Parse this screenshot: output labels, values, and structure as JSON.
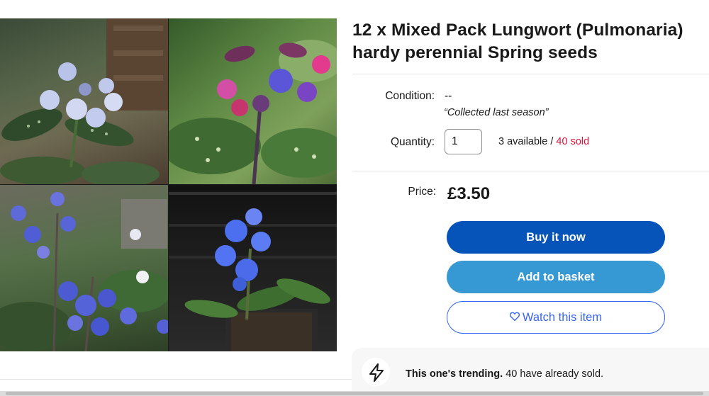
{
  "product": {
    "title": "12 x Mixed Pack Lungwort (Pulmonaria) hardy perennial Spring seeds",
    "image_alt": "Pulmonaria flowers collage"
  },
  "condition": {
    "label": "Condition:",
    "value": "--",
    "description": "“Collected last season”"
  },
  "quantity": {
    "label": "Quantity:",
    "value": "1",
    "available": "3 available",
    "separator": " / ",
    "sold": "40 sold"
  },
  "price": {
    "label": "Price:",
    "value": "£3.50"
  },
  "buttons": {
    "buy_now": "Buy it now",
    "add_to_basket": "Add to basket",
    "watch": "Watch this item"
  },
  "trending": {
    "bold": "This one's trending.",
    "text": " 40 have already sold."
  },
  "icons": {
    "watch": "heart-icon",
    "trending": "lightning-icon"
  },
  "colors": {
    "buy_now": "#0654ba",
    "add_to_basket": "#3799d3",
    "watch_border": "#3665f3",
    "sold_red": "#e0103a"
  }
}
